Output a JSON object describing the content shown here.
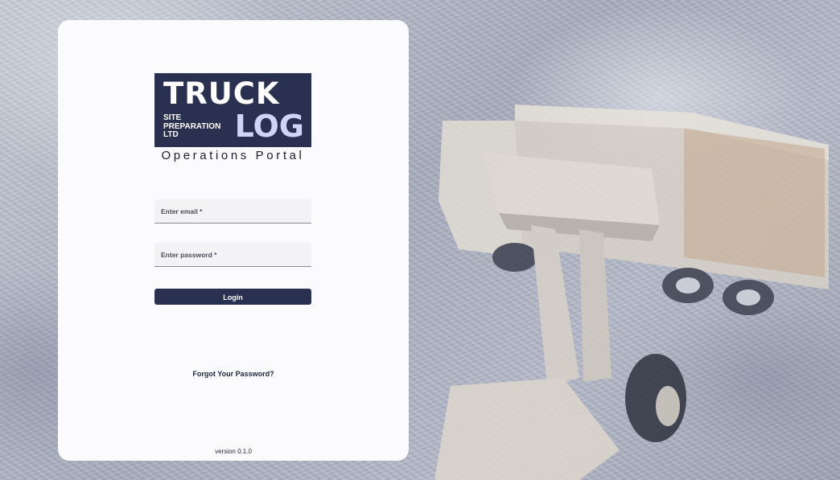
{
  "logo": {
    "line1": "TRUCK",
    "company_lines": [
      "SITE",
      "PREPARATION",
      "LTD"
    ],
    "line2": "LOG"
  },
  "subtitle": "Operations Portal",
  "form": {
    "email_placeholder": "Enter email *",
    "password_placeholder": "Enter password *",
    "login_label": "Login",
    "forgot_label": "Forgot Your Password?"
  },
  "version": "version 0.1.0",
  "colors": {
    "brand_navy": "#2a3150",
    "logo_accent": "#cfd6f4",
    "card_bg": "#fbfbfd"
  },
  "background": {
    "icon": "dump-truck-and-loader-photo"
  }
}
